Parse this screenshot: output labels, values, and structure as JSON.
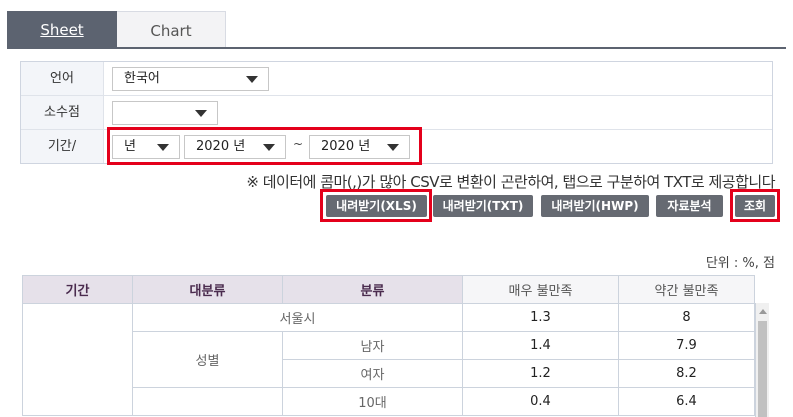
{
  "tabs": [
    {
      "label": "Sheet",
      "active": true
    },
    {
      "label": "Chart",
      "active": false
    }
  ],
  "filters": {
    "language": {
      "label": "언어",
      "value": "한국어"
    },
    "decimal": {
      "label": "소수점",
      "value": ""
    },
    "period": {
      "label": "기간/",
      "unit": "년",
      "from": "2020 년",
      "to": "2020 년",
      "separator": "~"
    }
  },
  "note": "※ 데이터에 콤마(,)가 많아 CSV로 변환이 곤란하여, 탭으로 구분하여 TXT로 제공합니다",
  "buttons": {
    "xls": "내려받기(XLS)",
    "txt": "내려받기(TXT)",
    "hwp": "내려받기(HWP)",
    "analysis": "자료분석",
    "search": "조회"
  },
  "unit_label": "단위 : %, 점",
  "table": {
    "headers": {
      "period": "기간",
      "major": "대분류",
      "category": "분류",
      "col1": "매우 불만족",
      "col2": "약간 불만족"
    },
    "rows": [
      {
        "major": "서울시",
        "category": "",
        "v1": "1.3",
        "v2": "8"
      },
      {
        "major": "성별",
        "category": "남자",
        "v1": "1.4",
        "v2": "7.9"
      },
      {
        "major": "",
        "category": "여자",
        "v1": "1.2",
        "v2": "8.2"
      },
      {
        "major": "",
        "category": "10대",
        "v1": "0.4",
        "v2": "6.4"
      }
    ]
  },
  "colors": {
    "accent_red": "#e4001b",
    "tab_active": "#5c6370",
    "button": "#666a72",
    "header_bg": "#e6e1ea"
  }
}
